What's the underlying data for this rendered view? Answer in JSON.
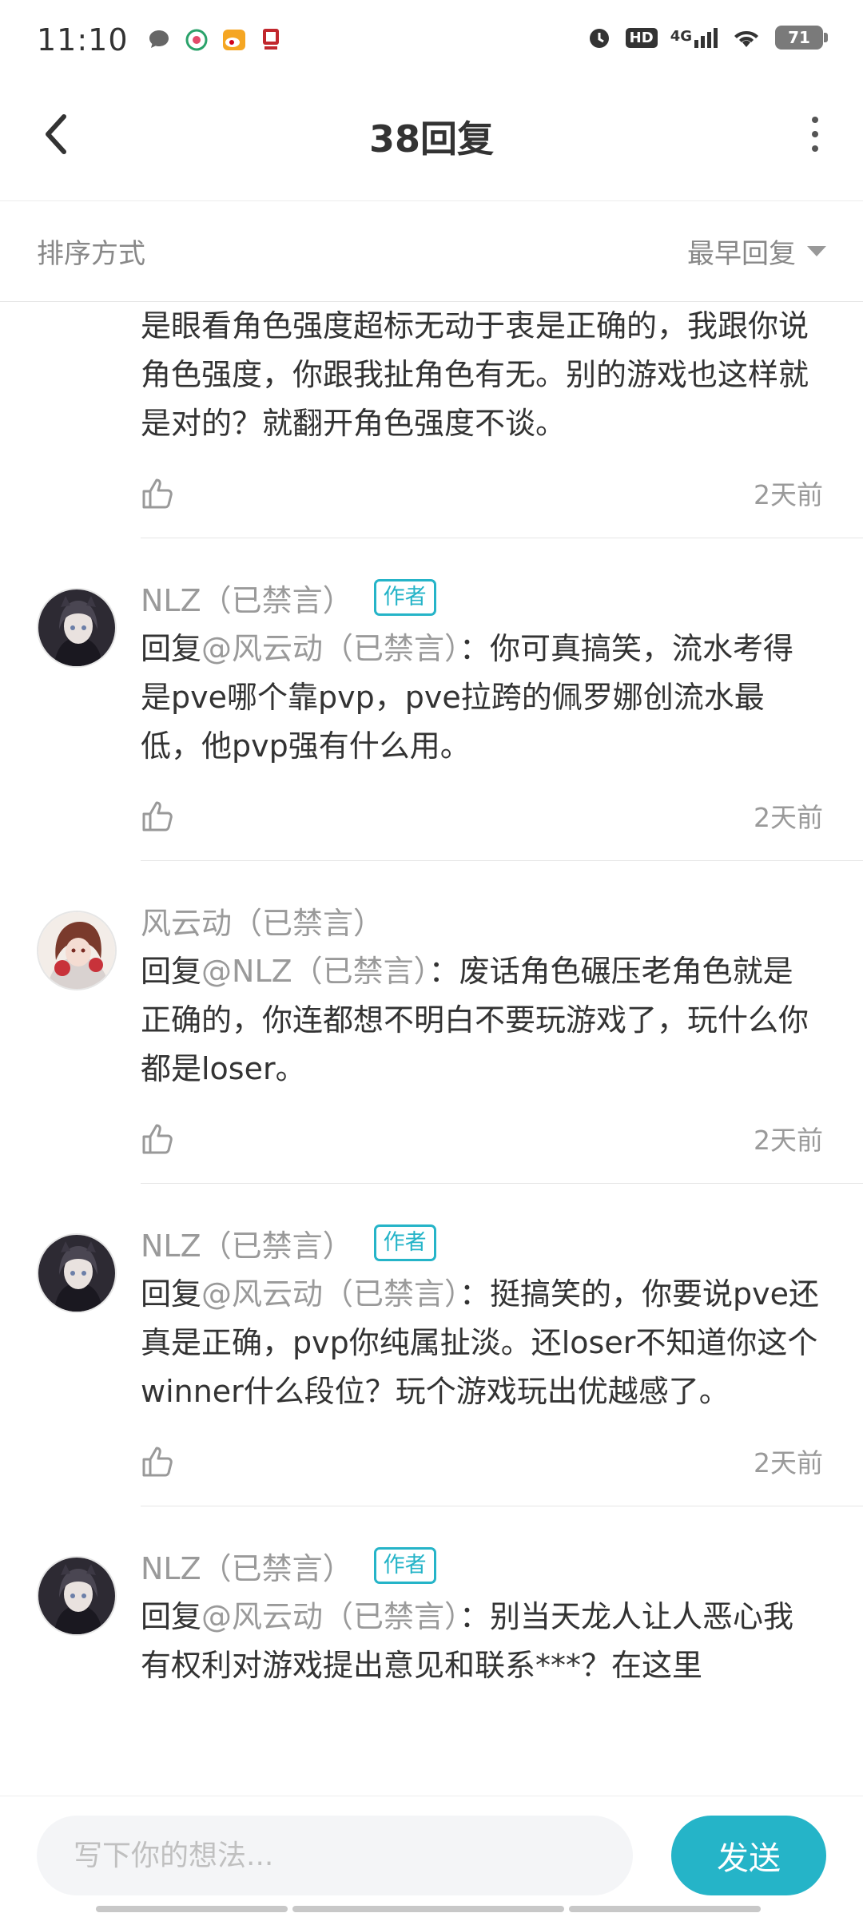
{
  "status_bar": {
    "time": "11:10",
    "hd": "HD",
    "network": "4G",
    "battery": "71",
    "left_icons": [
      "chat-bubble-icon",
      "app-icon",
      "weibo-icon",
      "app-logo-icon"
    ],
    "right_icons": [
      "alarm-icon",
      "hd-icon",
      "signal-icon",
      "wifi-icon",
      "battery-icon"
    ]
  },
  "header": {
    "title": "38回复",
    "back_icon": "chevron-left-icon",
    "more_icon": "more-vertical-icon"
  },
  "sort": {
    "label": "排序方式",
    "selected": "最早回复"
  },
  "replies": [
    {
      "continued": true,
      "text": "是眼看角色强度超标无动于衷是正确的，我跟你说角色强度，你跟我扯角色有无。别的游戏也这样就是对的？就翻开角色强度不谈。",
      "time": "2天前"
    },
    {
      "name": "NLZ（已禁言）",
      "badge": "作者",
      "reply_prefix": "回复",
      "mention": "@风云动（已禁言）",
      "colon": "：",
      "text": "你可真搞笑，流水考得是pve哪个靠pvp，pve拉跨的佩罗娜创流水最低，他pvp强有什么用。",
      "time": "2天前"
    },
    {
      "name": "风云动（已禁言）",
      "badge": "",
      "reply_prefix": "回复",
      "mention": "@NLZ（已禁言）",
      "colon": "：",
      "text": "废话角色碾压老角色就是正确的，你连都想不明白不要玩游戏了，玩什么你都是loser。",
      "time": "2天前"
    },
    {
      "name": "NLZ（已禁言）",
      "badge": "作者",
      "reply_prefix": "回复",
      "mention": "@风云动（已禁言）",
      "colon": "：",
      "text": "挺搞笑的，你要说pve还真是正确，pvp你纯属扯淡。还loser不知道你这个winner什么段位？玩个游戏玩出优越感了。",
      "time": "2天前"
    },
    {
      "name": "NLZ（已禁言）",
      "badge": "作者",
      "reply_prefix": "回复",
      "mention": "@风云动（已禁言）",
      "colon": "：",
      "text": "别当天龙人让人恶心我有权利对游戏提出意见和联系***？在这里",
      "time": ""
    }
  ],
  "composer": {
    "placeholder": "写下你的想法...",
    "send_label": "发送"
  },
  "colors": {
    "accent": "#25b4c8",
    "muted_text": "#9a9a9a",
    "body_text": "#333333"
  }
}
